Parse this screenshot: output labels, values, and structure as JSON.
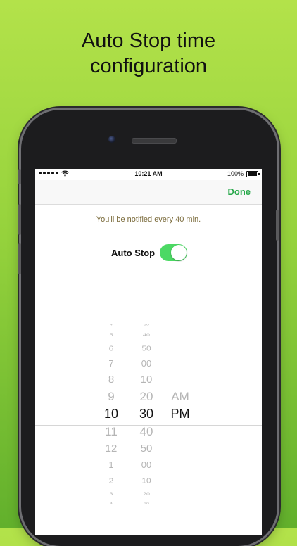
{
  "headline": {
    "line1": "Auto Stop time",
    "line2": "configuration"
  },
  "status_bar": {
    "time": "10:21 AM",
    "battery": "100%"
  },
  "nav": {
    "done_label": "Done"
  },
  "notice_text": "You'll be notified every 40 min.",
  "auto_stop": {
    "label": "Auto Stop",
    "enabled": true
  },
  "picker": {
    "hours": [
      "4",
      "5",
      "6",
      "7",
      "8",
      "9",
      "10",
      "11",
      "12",
      "1",
      "2",
      "3",
      "4"
    ],
    "minutes": [
      "30",
      "40",
      "50",
      "00",
      "10",
      "20",
      "30",
      "40",
      "50",
      "00",
      "10",
      "20",
      "30"
    ],
    "periods": [
      "AM",
      "PM"
    ],
    "selected": {
      "hour": "10",
      "minute": "30",
      "period": "PM"
    }
  },
  "colors": {
    "accent": "#27a84a",
    "toggle_on": "#4cd964",
    "notice_text": "#7a6a3a"
  }
}
